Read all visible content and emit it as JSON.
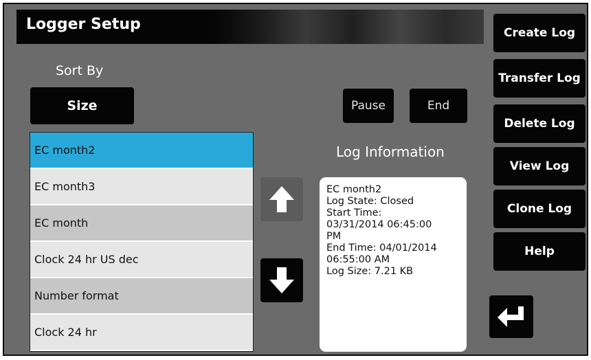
{
  "header": {
    "title": "Logger Setup"
  },
  "sort": {
    "label": "Sort By",
    "button_label": "Size"
  },
  "controls": {
    "pause_label": "Pause",
    "end_label": "End"
  },
  "log_list": {
    "items": [
      {
        "label": "EC month2",
        "selected": true
      },
      {
        "label": "EC month3",
        "selected": false
      },
      {
        "label": "EC month",
        "selected": false
      },
      {
        "label": "Clock 24 hr US dec",
        "selected": false
      },
      {
        "label": "Number format",
        "selected": false
      },
      {
        "label": "Clock 24 hr",
        "selected": false
      }
    ],
    "scroll_up_icon": "arrow-up-icon",
    "scroll_down_icon": "arrow-down-icon"
  },
  "log_info": {
    "label": "Log Information",
    "lines": [
      "EC month2",
      "Log State: Closed",
      "Start Time:",
      "03/31/2014 06:45:00",
      "PM",
      "End Time: 04/01/2014",
      "06:55:00 AM",
      "Log Size: 7.21 KB"
    ]
  },
  "side_menu": {
    "items": [
      {
        "label": "Create Log"
      },
      {
        "label": "Transfer Log"
      },
      {
        "label": "Delete Log"
      },
      {
        "label": "View Log"
      },
      {
        "label": "Clone Log"
      },
      {
        "label": "Help"
      }
    ]
  },
  "enter_icon": "enter-return-icon",
  "colors": {
    "background": "#6b6b6b",
    "button": "#050505",
    "selected_row": "#29a9d9",
    "row_light": "#e6e6e6",
    "row_dark": "#c6c6c6"
  }
}
